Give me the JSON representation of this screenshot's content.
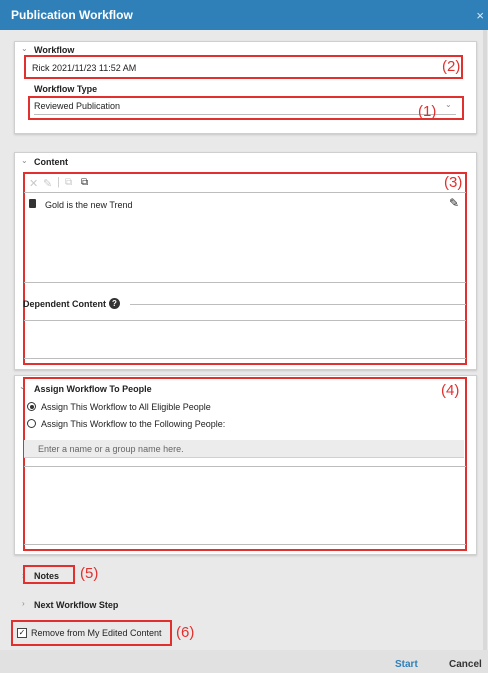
{
  "window": {
    "title": "Publication Workflow",
    "close_glyph": "×"
  },
  "workflow": {
    "section_label": "Workflow",
    "name_value": "Rick 2021/11/23 11:52 AM",
    "type_label": "Workflow Type",
    "type_value": "Reviewed Publication"
  },
  "content": {
    "section_label": "Content",
    "items": [
      {
        "title": "Gold is the new Trend"
      }
    ],
    "dependent_label": "Dependent Content",
    "help_glyph": "?"
  },
  "assign": {
    "section_label": "Assign Workflow To People",
    "option_all": "Assign This Workflow to All Eligible People",
    "option_following": "Assign This Workflow to the Following People:",
    "input_placeholder": "Enter a name or a group name here."
  },
  "notes": {
    "label": "Notes"
  },
  "next_step": {
    "label": "Next Workflow Step"
  },
  "remove_option": {
    "label": "Remove from My Edited Content",
    "checked": true
  },
  "buttons": {
    "start": "Start",
    "cancel": "Cancel"
  },
  "callouts": {
    "c1": "(1)",
    "c2": "(2)",
    "c3": "(3)",
    "c4": "(4)",
    "c5": "(5)",
    "c6": "(6)"
  },
  "colors": {
    "titlebar": "#2f80b9",
    "callout": "#e0312f",
    "primary_button": "#2f80b9"
  }
}
